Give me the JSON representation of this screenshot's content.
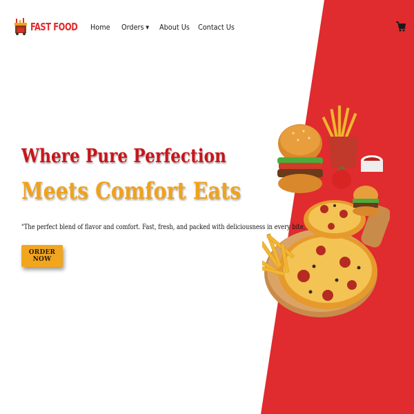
{
  "brand": {
    "name": "FAST FOOD",
    "color": "#e02b2f"
  },
  "nav": {
    "items": [
      {
        "label": "Home"
      },
      {
        "label": "Orders",
        "has_dropdown": true,
        "caret": "▼"
      },
      {
        "label": "About Us"
      },
      {
        "label": "Contact Us"
      }
    ],
    "cart_icon": "cart-icon"
  },
  "hero": {
    "headline_1": "Where Pure Perfection",
    "headline_2": "Meets Comfort Eats",
    "tagline": "\"The perfect blend of flavor and comfort. Fast, fresh, and packed with deliciousness in every bite.\"",
    "cta_label": "ORDER NOW",
    "image": "fast-food-platter"
  },
  "colors": {
    "accent_red": "#e02b2f",
    "headline_red": "#c8151b",
    "accent_orange": "#f0a21b",
    "button": "#f2a51f"
  }
}
